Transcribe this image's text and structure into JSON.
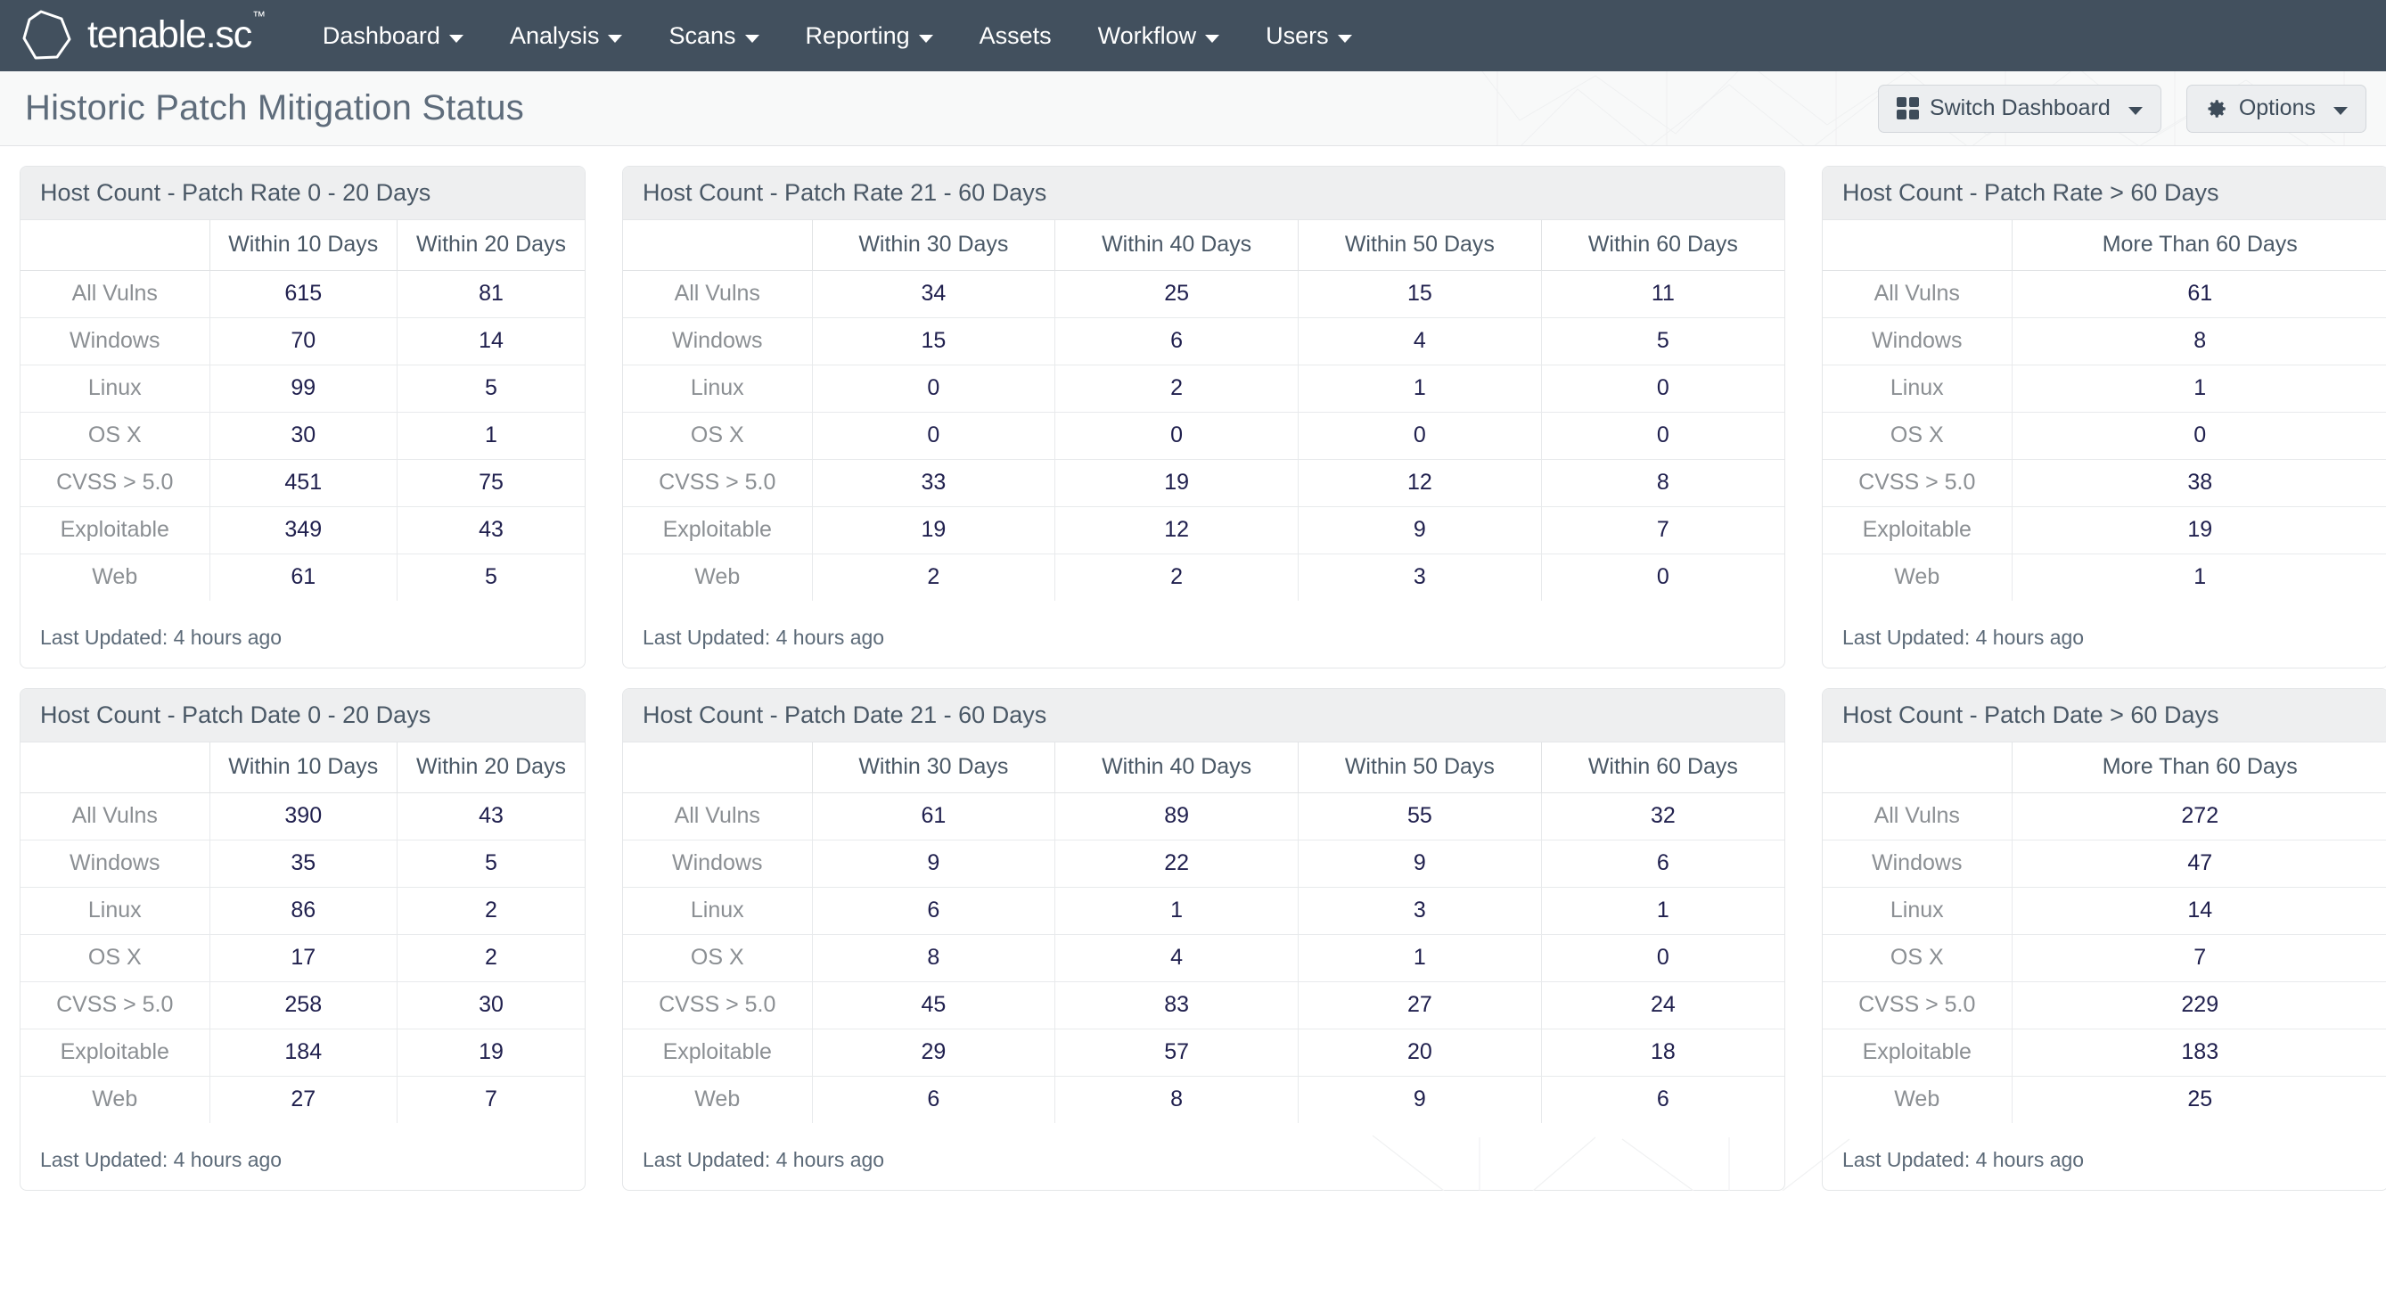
{
  "navbar": {
    "brand": {
      "name": "tenable.sc",
      "tm": "™",
      "logo_icon": "hexagon-logo"
    },
    "items": [
      {
        "label": "Dashboard",
        "has_caret": true
      },
      {
        "label": "Analysis",
        "has_caret": true
      },
      {
        "label": "Scans",
        "has_caret": true
      },
      {
        "label": "Reporting",
        "has_caret": true
      },
      {
        "label": "Assets",
        "has_caret": false
      },
      {
        "label": "Workflow",
        "has_caret": true
      },
      {
        "label": "Users",
        "has_caret": true
      }
    ]
  },
  "header": {
    "title": "Historic Patch Mitigation Status",
    "switch_dashboard_label": "Switch Dashboard",
    "options_label": "Options"
  },
  "colors": {
    "navbar_bg": "#42505e",
    "page_header_bg": "#f8f9f9",
    "panel_header_bg": "#eeeff0",
    "title_text": "#5e6c7b",
    "value_text": "#20204e",
    "rowlabel_text": "#8b8f93"
  },
  "row_labels": [
    "All Vulns",
    "Windows",
    "Linux",
    "OS X",
    "CVSS > 5.0",
    "Exploitable",
    "Web"
  ],
  "last_updated_label": "Last Updated: 4 hours ago",
  "panels": [
    {
      "id": "patch-rate-0-20",
      "title": "Host Count - Patch Rate 0 - 20 Days",
      "columns": [
        "",
        "Within 10 Days",
        "Within 20 Days"
      ],
      "rows": [
        {
          "label": "All Vulns",
          "values": [
            "615",
            "81"
          ]
        },
        {
          "label": "Windows",
          "values": [
            "70",
            "14"
          ]
        },
        {
          "label": "Linux",
          "values": [
            "99",
            "5"
          ]
        },
        {
          "label": "OS X",
          "values": [
            "30",
            "1"
          ]
        },
        {
          "label": "CVSS > 5.0",
          "values": [
            "451",
            "75"
          ]
        },
        {
          "label": "Exploitable",
          "values": [
            "349",
            "43"
          ]
        },
        {
          "label": "Web",
          "values": [
            "61",
            "5"
          ]
        }
      ],
      "footer": "Last Updated: 4 hours ago"
    },
    {
      "id": "patch-rate-21-60",
      "title": "Host Count - Patch Rate 21 - 60 Days",
      "columns": [
        "",
        "Within 30 Days",
        "Within 40 Days",
        "Within 50 Days",
        "Within 60 Days"
      ],
      "rows": [
        {
          "label": "All Vulns",
          "values": [
            "34",
            "25",
            "15",
            "11"
          ]
        },
        {
          "label": "Windows",
          "values": [
            "15",
            "6",
            "4",
            "5"
          ]
        },
        {
          "label": "Linux",
          "values": [
            "0",
            "2",
            "1",
            "0"
          ]
        },
        {
          "label": "OS X",
          "values": [
            "0",
            "0",
            "0",
            "0"
          ]
        },
        {
          "label": "CVSS > 5.0",
          "values": [
            "33",
            "19",
            "12",
            "8"
          ]
        },
        {
          "label": "Exploitable",
          "values": [
            "19",
            "12",
            "9",
            "7"
          ]
        },
        {
          "label": "Web",
          "values": [
            "2",
            "2",
            "3",
            "0"
          ]
        }
      ],
      "footer": "Last Updated: 4 hours ago"
    },
    {
      "id": "patch-rate-gt-60",
      "title": "Host Count - Patch Rate > 60 Days",
      "columns": [
        "",
        "More Than 60 Days"
      ],
      "rows": [
        {
          "label": "All Vulns",
          "values": [
            "61"
          ]
        },
        {
          "label": "Windows",
          "values": [
            "8"
          ]
        },
        {
          "label": "Linux",
          "values": [
            "1"
          ]
        },
        {
          "label": "OS X",
          "values": [
            "0"
          ]
        },
        {
          "label": "CVSS > 5.0",
          "values": [
            "38"
          ]
        },
        {
          "label": "Exploitable",
          "values": [
            "19"
          ]
        },
        {
          "label": "Web",
          "values": [
            "1"
          ]
        }
      ],
      "footer": "Last Updated: 4 hours ago"
    },
    {
      "id": "patch-date-0-20",
      "title": "Host Count - Patch Date 0 - 20 Days",
      "columns": [
        "",
        "Within 10 Days",
        "Within 20 Days"
      ],
      "rows": [
        {
          "label": "All Vulns",
          "values": [
            "390",
            "43"
          ]
        },
        {
          "label": "Windows",
          "values": [
            "35",
            "5"
          ]
        },
        {
          "label": "Linux",
          "values": [
            "86",
            "2"
          ]
        },
        {
          "label": "OS X",
          "values": [
            "17",
            "2"
          ]
        },
        {
          "label": "CVSS > 5.0",
          "values": [
            "258",
            "30"
          ]
        },
        {
          "label": "Exploitable",
          "values": [
            "184",
            "19"
          ]
        },
        {
          "label": "Web",
          "values": [
            "27",
            "7"
          ]
        }
      ],
      "footer": "Last Updated: 4 hours ago"
    },
    {
      "id": "patch-date-21-60",
      "title": "Host Count - Patch Date 21 - 60 Days",
      "columns": [
        "",
        "Within 30 Days",
        "Within 40 Days",
        "Within 50 Days",
        "Within 60 Days"
      ],
      "rows": [
        {
          "label": "All Vulns",
          "values": [
            "61",
            "89",
            "55",
            "32"
          ]
        },
        {
          "label": "Windows",
          "values": [
            "9",
            "22",
            "9",
            "6"
          ]
        },
        {
          "label": "Linux",
          "values": [
            "6",
            "1",
            "3",
            "1"
          ]
        },
        {
          "label": "OS X",
          "values": [
            "8",
            "4",
            "1",
            "0"
          ]
        },
        {
          "label": "CVSS > 5.0",
          "values": [
            "45",
            "83",
            "27",
            "24"
          ]
        },
        {
          "label": "Exploitable",
          "values": [
            "29",
            "57",
            "20",
            "18"
          ]
        },
        {
          "label": "Web",
          "values": [
            "6",
            "8",
            "9",
            "6"
          ]
        }
      ],
      "footer": "Last Updated: 4 hours ago"
    },
    {
      "id": "patch-date-gt-60",
      "title": "Host Count - Patch Date > 60 Days",
      "columns": [
        "",
        "More Than 60 Days"
      ],
      "rows": [
        {
          "label": "All Vulns",
          "values": [
            "272"
          ]
        },
        {
          "label": "Windows",
          "values": [
            "47"
          ]
        },
        {
          "label": "Linux",
          "values": [
            "14"
          ]
        },
        {
          "label": "OS X",
          "values": [
            "7"
          ]
        },
        {
          "label": "CVSS > 5.0",
          "values": [
            "229"
          ]
        },
        {
          "label": "Exploitable",
          "values": [
            "183"
          ]
        },
        {
          "label": "Web",
          "values": [
            "25"
          ]
        }
      ],
      "footer": "Last Updated: 4 hours ago"
    }
  ]
}
